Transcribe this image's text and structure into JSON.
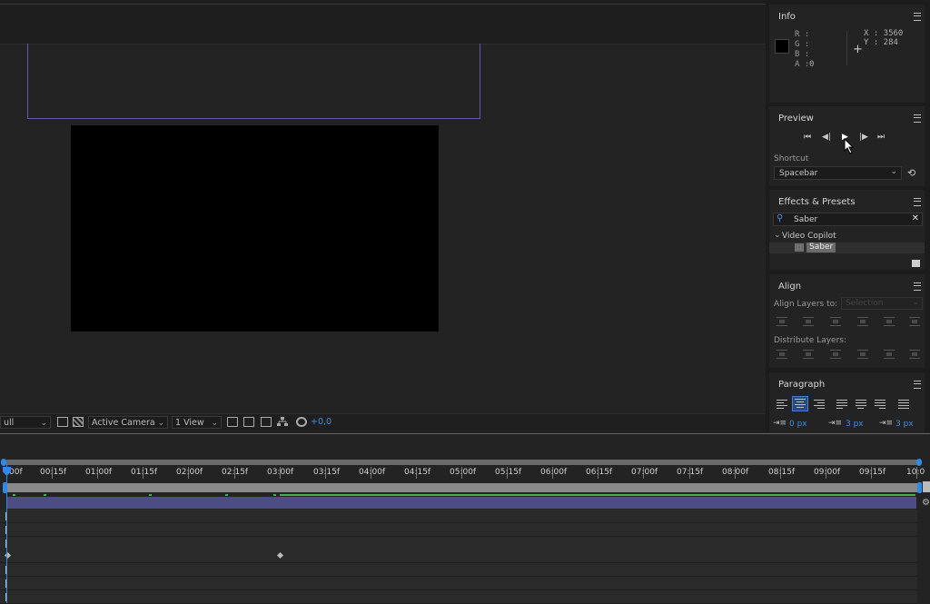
{
  "info": {
    "title": "Info",
    "r_label": "R :",
    "g_label": "G :",
    "b_label": "B :",
    "a_label": "A :",
    "a_value": "0",
    "x_label": "X : 3560",
    "y_label": "Y : 284"
  },
  "preview": {
    "title": "Preview",
    "shortcut_label": "Shortcut",
    "shortcut_value": "Spacebar"
  },
  "effects": {
    "title": "Effects & Presets",
    "search_value": "Saber",
    "folder": "Video Copilot",
    "item": "Saber"
  },
  "align": {
    "title": "Align",
    "align_layers_label": "Align Layers to:",
    "align_layers_value": "Selection",
    "distribute_label": "Distribute Layers:"
  },
  "paragraph": {
    "title": "Paragraph",
    "indent_left": "0 px",
    "space_before": "3 px",
    "space_after": "3 px"
  },
  "viewer_bar": {
    "resolution": "ull",
    "camera": "Active Camera",
    "views": "1 View",
    "exposure": "+0,0"
  },
  "timeline": {
    "ticks": [
      "00f",
      "00:15f",
      "01:00f",
      "01:15f",
      "02:00f",
      "02:15f",
      "03:00f",
      "03:15f",
      "04:00f",
      "04:15f",
      "05:00f",
      "05:15f",
      "06:00f",
      "06:15f",
      "07:00f",
      "07:15f",
      "08:00f",
      "08:15f",
      "09:00f",
      "09:15f",
      "10:0"
    ]
  },
  "colors": {
    "accent": "#2e8ae6",
    "layer_bar": "#4d4d86",
    "work_area_green": "#3db34a"
  }
}
